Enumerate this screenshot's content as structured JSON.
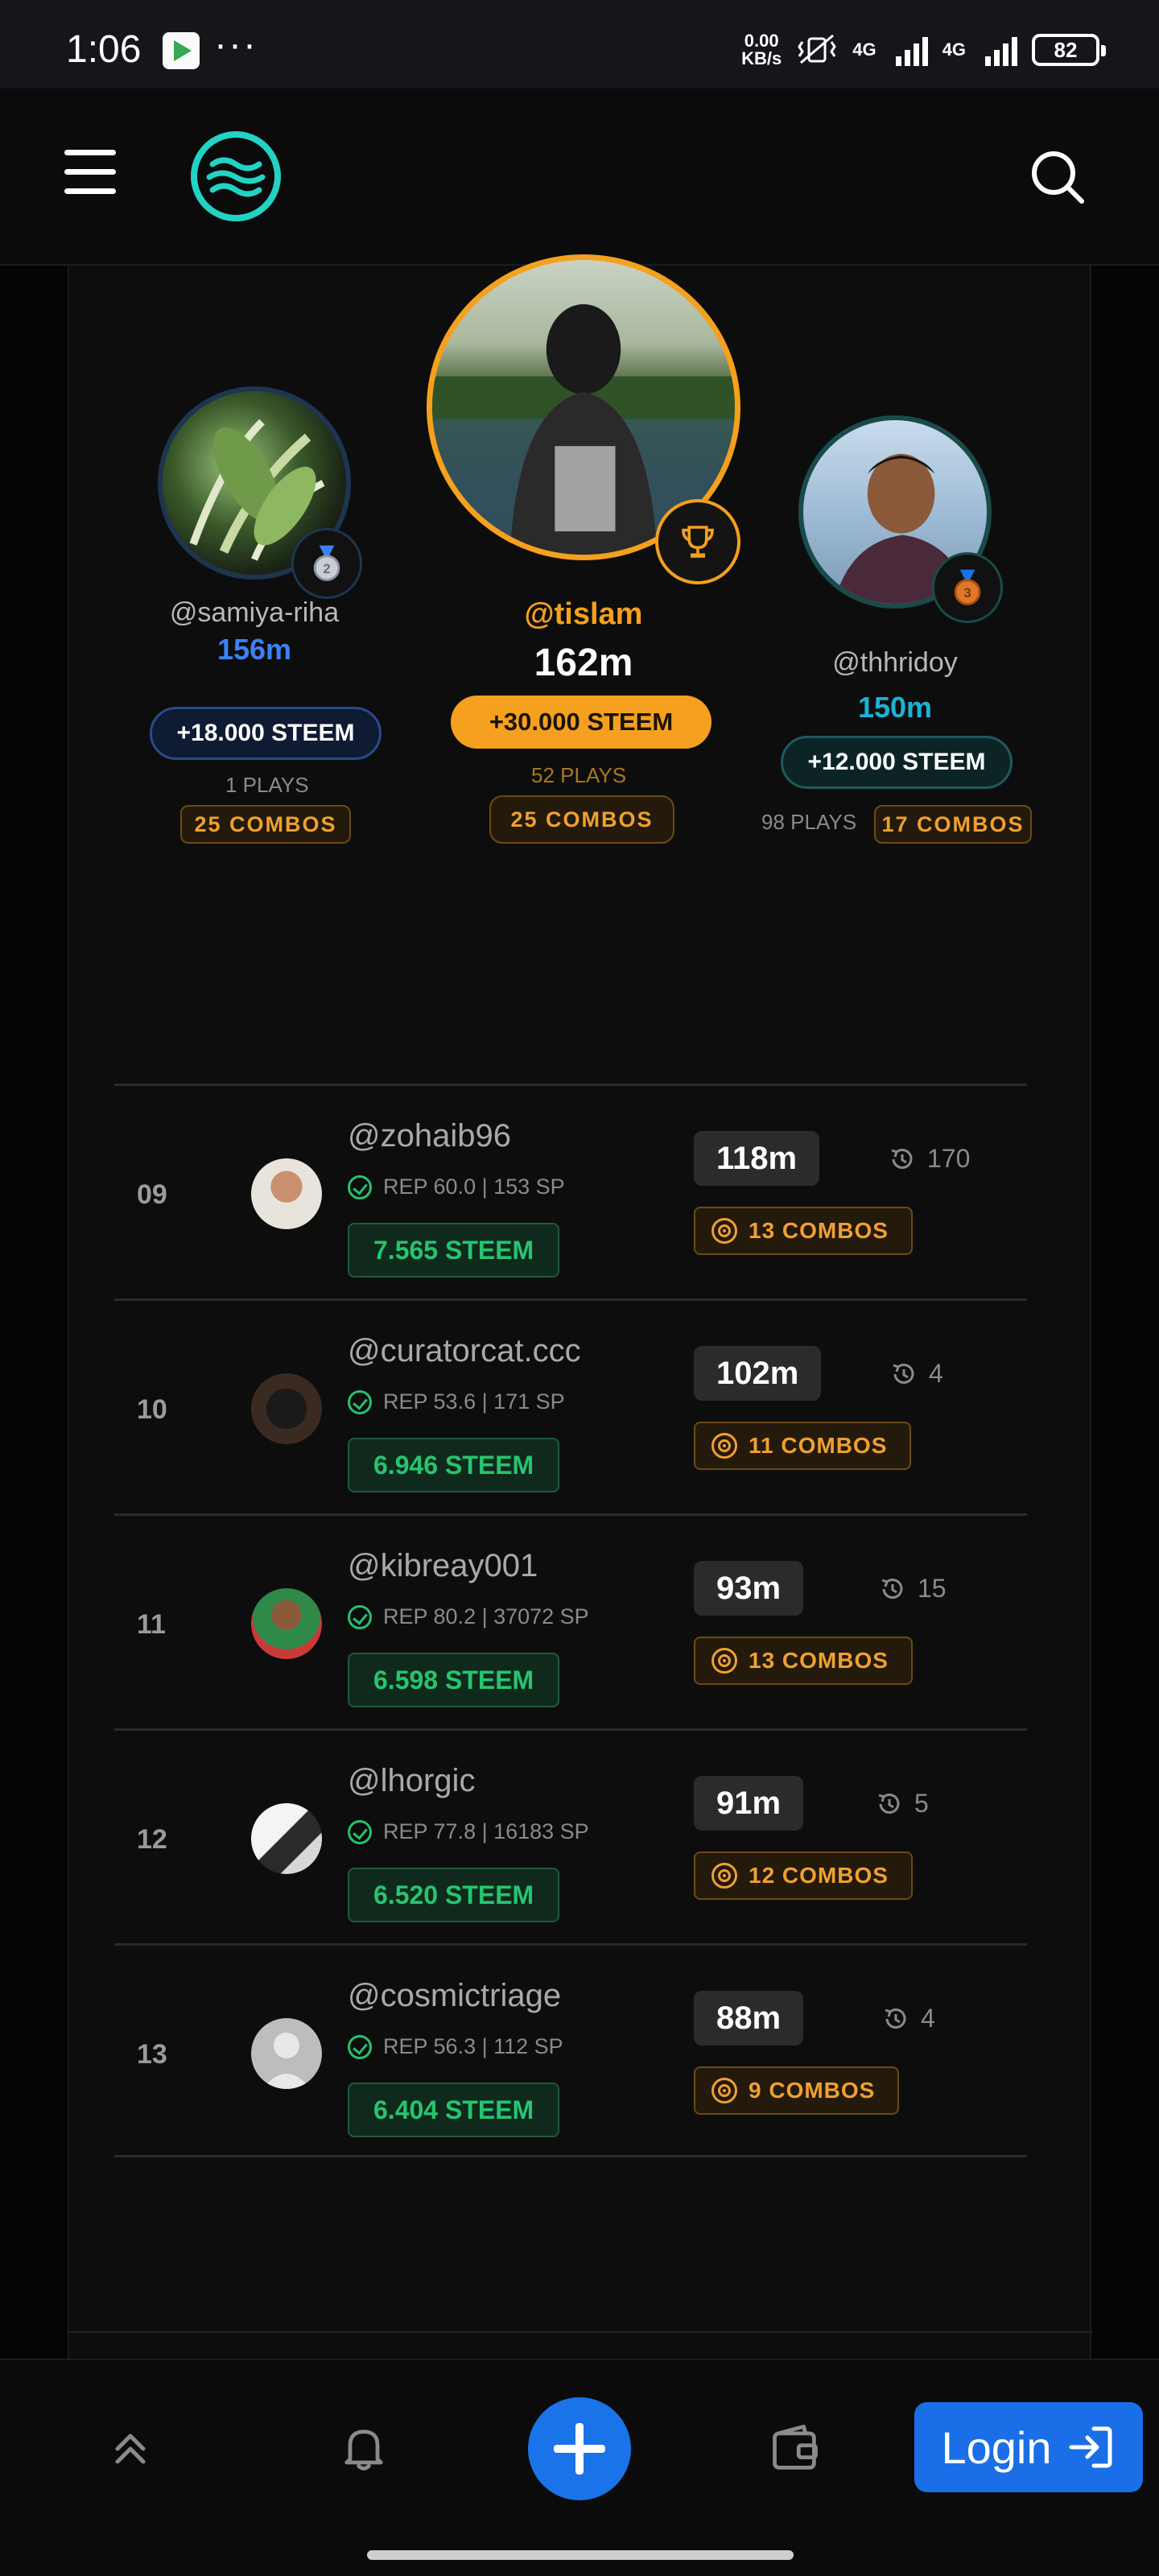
{
  "status_bar": {
    "time": "1:06",
    "dots": "···",
    "speed_value": "0.00",
    "speed_unit": "KB/s",
    "network_1": "4G",
    "network_2": "4G",
    "battery": "82"
  },
  "header": {
    "menu_icon": "hamburger-menu-icon",
    "logo_icon": "wave-logo-icon",
    "search_icon": "search-icon"
  },
  "podium": {
    "second": {
      "username": "@samiya-riha",
      "score": "156m",
      "reward": "+18.000 STEEM",
      "plays": "1 PLAYS",
      "combos": "25 COMBOS",
      "medal": "2"
    },
    "first": {
      "username": "@tislam",
      "score": "162m",
      "reward": "+30.000 STEEM",
      "plays": "52 PLAYS",
      "combos": "25 COMBOS"
    },
    "third": {
      "username": "@thhridoy",
      "score": "150m",
      "reward": "+12.000 STEEM",
      "plays": "98 PLAYS",
      "combos": "17 COMBOS",
      "medal": "3"
    }
  },
  "leaderboard": [
    {
      "rank": "09",
      "username": "@zohaib96",
      "rep": "REP 60.0 | 153 SP",
      "steem": "7.565 STEEM",
      "score": "118m",
      "plays": "170",
      "combos": "13 COMBOS"
    },
    {
      "rank": "10",
      "username": "@curatorcat.ccc",
      "rep": "REP 53.6 | 171 SP",
      "steem": "6.946 STEEM",
      "score": "102m",
      "plays": "4",
      "combos": "11 COMBOS"
    },
    {
      "rank": "11",
      "username": "@kibreay001",
      "rep": "REP 80.2 | 37072 SP",
      "steem": "6.598 STEEM",
      "score": "93m",
      "plays": "15",
      "combos": "13 COMBOS"
    },
    {
      "rank": "12",
      "username": "@lhorgic",
      "rep": "REP 77.8 | 16183 SP",
      "steem": "6.520 STEEM",
      "score": "91m",
      "plays": "5",
      "combos": "12 COMBOS"
    },
    {
      "rank": "13",
      "username": "@cosmictriage",
      "rep": "REP 56.3 | 112 SP",
      "steem": "6.404 STEEM",
      "score": "88m",
      "plays": "4",
      "combos": "9 COMBOS"
    }
  ],
  "bottom_nav": {
    "login_label": "Login"
  },
  "colors": {
    "gold": "#f5a01e",
    "silver_blue": "#3b82f6",
    "teal": "#1ab3d6",
    "steem_green": "#27c46f",
    "combo_orange": "#f0a030",
    "accent_blue": "#1a73e8"
  }
}
